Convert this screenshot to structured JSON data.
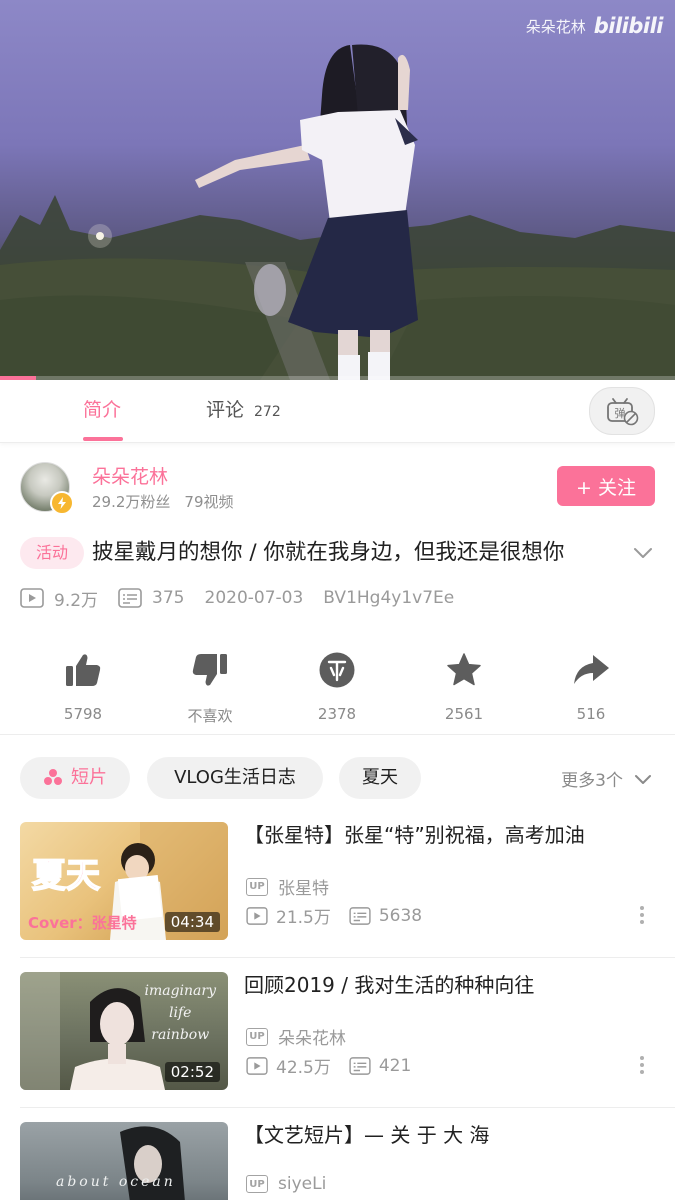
{
  "player": {
    "watermark_text": "朵朵花林",
    "watermark_logo": "bilibili",
    "progress_fraction": 0.053
  },
  "tabs": {
    "intro": "简介",
    "comments": "评论",
    "comments_count": "272",
    "danmaku_toggle_icon": "danmaku-off-icon"
  },
  "uploader": {
    "name": "朵朵花林",
    "followers": "29.2万粉丝",
    "videos": "79视频",
    "follow_label": "+ 关注"
  },
  "video": {
    "tag": "活动",
    "title": "披星戴月的想你  /  你就在我身边，但我还是很想你",
    "views": "9.2万",
    "danmaku": "375",
    "date": "2020-07-03",
    "bvid": "BV1Hg4y1v7Ee"
  },
  "actions": {
    "like": "5798",
    "dislike": "不喜欢",
    "coin": "2378",
    "favorite": "2561",
    "share": "516"
  },
  "tags": {
    "items": [
      "短片",
      "VLOG生活日志",
      "夏天"
    ],
    "more": "更多3个"
  },
  "related": [
    {
      "title": "【张星特】张星“特”别祝福，高考加油",
      "up": "张星特",
      "views": "21.5万",
      "danmaku": "5638",
      "duration": "04:34",
      "thumb_text_big": "夏天",
      "thumb_text_small": "Cover：张星特"
    },
    {
      "title": "回顾2019  /  我对生活的种种向往",
      "up": "朵朵花林",
      "views": "42.5万",
      "danmaku": "421",
      "duration": "02:52",
      "thumb_lines": [
        "imaginary",
        "life",
        "rainbow"
      ]
    },
    {
      "title": "【文艺短片】—   关  于  大  海",
      "up": "siyeLi",
      "thumb_text": "about ocean"
    }
  ],
  "colors": {
    "accent": "#fb7299",
    "coin_badge": "#f7b731"
  }
}
